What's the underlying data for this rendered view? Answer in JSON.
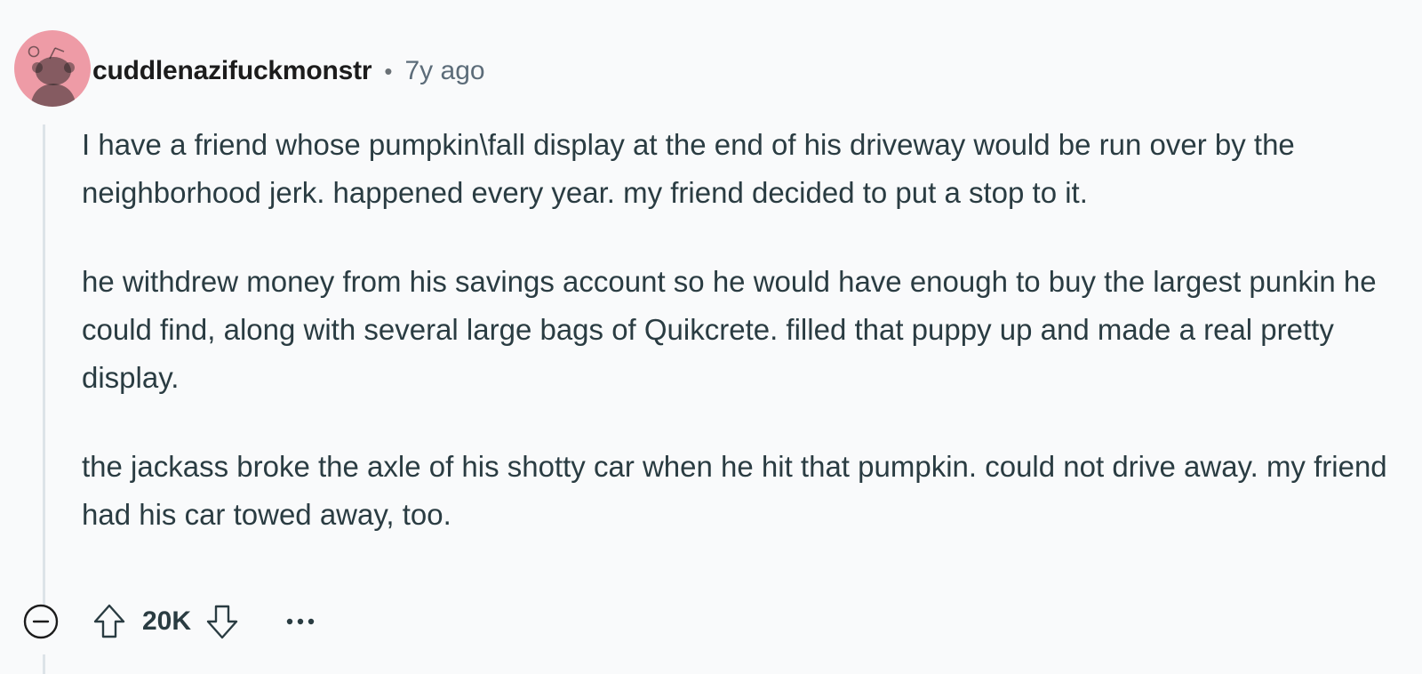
{
  "comment": {
    "author": "cuddlenazifuckmonstr",
    "separator": "•",
    "age": "7y ago",
    "paragraphs": [
      "I have a friend whose pumpkin\\fall display at the end of his driveway would be run over by the neighborhood jerk. happened every year. my friend decided to put a stop to it.",
      "he withdrew money from his savings account so he would have enough to buy the largest punkin he could find, along with several large bags of Quikcrete. filled that puppy up and made a real pretty display.",
      "the jackass broke the axle of his shotty car when he hit that pumpkin. could not drive away. my friend had his car towed away, too."
    ],
    "score": "20K"
  },
  "icons": {
    "avatar": "snoo-avatar",
    "collapse": "collapse-minus-icon",
    "upvote": "upvote-arrow-icon",
    "downvote": "downvote-arrow-icon",
    "more": "more-options-icon"
  },
  "colors": {
    "background": "#f9fafb",
    "avatar_bg": "#ee9ba6",
    "text": "#2a3c42",
    "meta": "#5c6c79",
    "thread_line": "#dde3e8"
  }
}
